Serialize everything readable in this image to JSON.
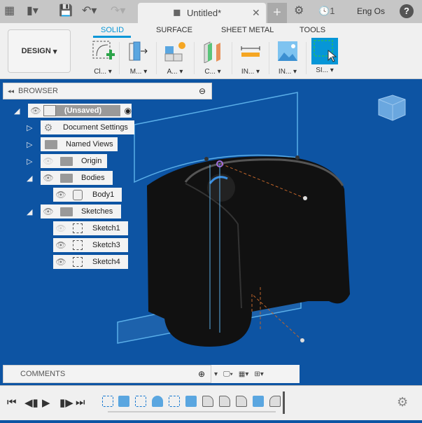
{
  "topbar": {
    "tab_title": "Untitled*",
    "job_count": "1",
    "user": "Eng Os",
    "help": "?"
  },
  "ribbon": {
    "workspace": "DESIGN",
    "tabs": [
      "SOLID",
      "SURFACE",
      "SHEET METAL",
      "TOOLS"
    ],
    "active_tab": "SOLID",
    "tools": [
      {
        "label": "Cl...",
        "icon": "create-sketch-icon"
      },
      {
        "label": "M...",
        "icon": "modify-icon"
      },
      {
        "label": "A...",
        "icon": "assemble-icon"
      },
      {
        "label": "C...",
        "icon": "construct-icon"
      },
      {
        "label": "IN...",
        "icon": "inspect-icon"
      },
      {
        "label": "IN...",
        "icon": "insert-icon"
      },
      {
        "label": "SI...",
        "icon": "select-icon"
      }
    ]
  },
  "browser": {
    "title": "BROWSER",
    "root": "(Unsaved)",
    "items": [
      {
        "label": "Document Settings"
      },
      {
        "label": "Named Views"
      },
      {
        "label": "Origin"
      },
      {
        "label": "Bodies"
      },
      {
        "label": "Body1"
      },
      {
        "label": "Sketches"
      },
      {
        "label": "Sketch1"
      },
      {
        "label": "Sketch3"
      },
      {
        "label": "Sketch4"
      }
    ]
  },
  "comments": {
    "title": "COMMENTS"
  },
  "colors": {
    "viewport": "#0d54a3",
    "accent": "#0696d7"
  }
}
